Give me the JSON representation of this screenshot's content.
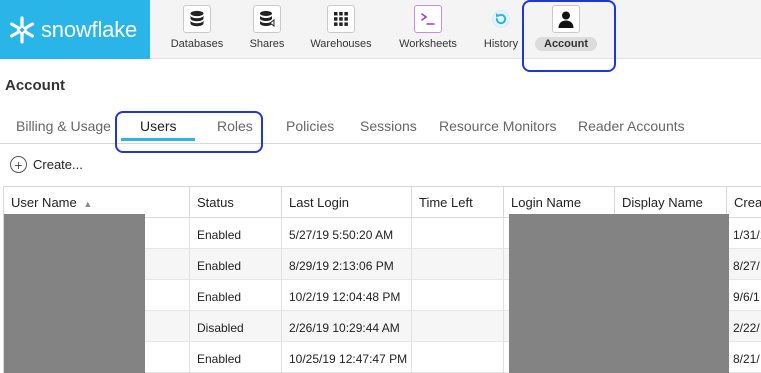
{
  "brand": {
    "name": "snowflake"
  },
  "nav": {
    "items": [
      {
        "label": "Databases",
        "icon": "database-icon"
      },
      {
        "label": "Shares",
        "icon": "shares-icon"
      },
      {
        "label": "Warehouses",
        "icon": "warehouse-icon"
      },
      {
        "label": "Worksheets",
        "icon": "worksheet-icon"
      },
      {
        "label": "History",
        "icon": "history-icon"
      },
      {
        "label": "Account",
        "icon": "account-icon",
        "active": true
      }
    ]
  },
  "page": {
    "title": "Account"
  },
  "subnav": {
    "tabs": [
      {
        "label": "Billing & Usage"
      },
      {
        "label": "Users",
        "active": true
      },
      {
        "label": "Roles"
      },
      {
        "label": "Policies"
      },
      {
        "label": "Sessions"
      },
      {
        "label": "Resource Monitors"
      },
      {
        "label": "Reader Accounts"
      }
    ]
  },
  "create": {
    "label": "Create..."
  },
  "table": {
    "columns": [
      "User Name",
      "Status",
      "Last Login",
      "Time Left",
      "Login Name",
      "Display Name",
      "Crea"
    ],
    "rows": [
      {
        "status": "Enabled",
        "last_login": "5/27/19 5:50:20 AM",
        "created": "1/31/1"
      },
      {
        "status": "Enabled",
        "last_login": "8/29/19 2:13:06 PM",
        "created": "8/27/"
      },
      {
        "status": "Enabled",
        "last_login": "10/2/19 12:04:48 PM",
        "created": "9/6/1"
      },
      {
        "status": "Disabled",
        "last_login": "2/26/19 10:29:44 AM",
        "created": "2/22/"
      },
      {
        "status": "Enabled",
        "last_login": "10/25/19 12:47:47 PM",
        "created": "8/21/"
      }
    ]
  },
  "colors": {
    "brand": "#29b5e8",
    "highlight": "#2136d9",
    "redaction": "#838383"
  }
}
